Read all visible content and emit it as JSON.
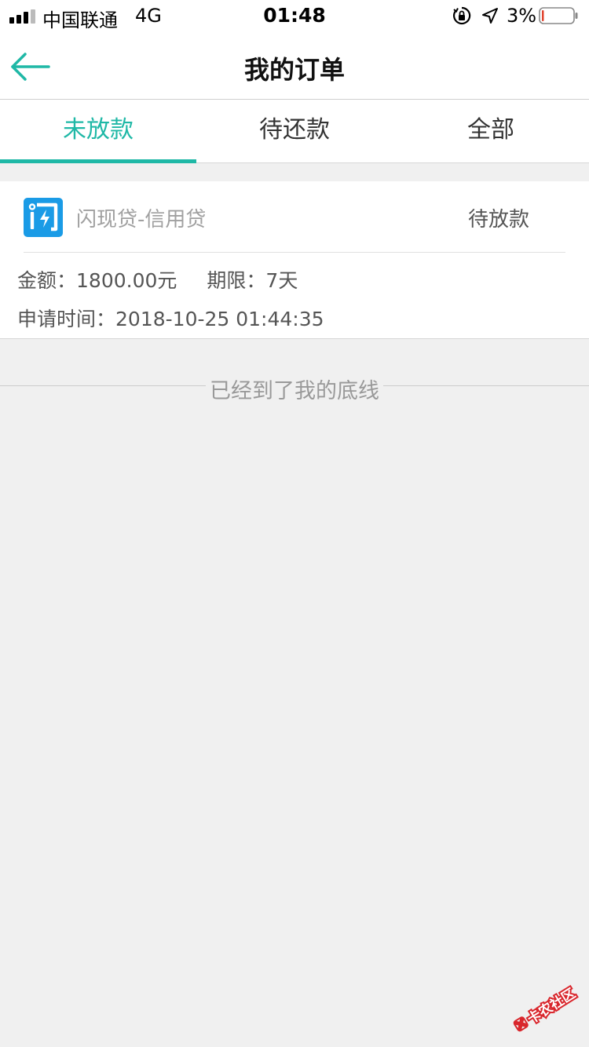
{
  "status_bar": {
    "carrier": "中国联通",
    "network": "4G",
    "time": "01:48",
    "battery_percent": "3%",
    "battery_color": "#e0432e"
  },
  "nav": {
    "title": "我的订单",
    "back_icon": "arrow-left-icon",
    "accent_color": "#1fb8a6"
  },
  "tabs": [
    {
      "label": "未放款",
      "active": true
    },
    {
      "label": "待还款",
      "active": false
    },
    {
      "label": "全部",
      "active": false
    }
  ],
  "orders": [
    {
      "product_name": "闪现贷-信用贷",
      "status": "待放款",
      "amount_label": "金额：",
      "amount_value": "1800.00元",
      "term_label": "期限：",
      "term_value": "7天",
      "time_label": "申请时间：",
      "time_value": "2018-10-25 01:44:35",
      "logo_color": "#1a9be6"
    }
  ],
  "end_text": "已经到了我的底线",
  "watermark": {
    "text": "卡农社区",
    "color": "#d9262c"
  }
}
